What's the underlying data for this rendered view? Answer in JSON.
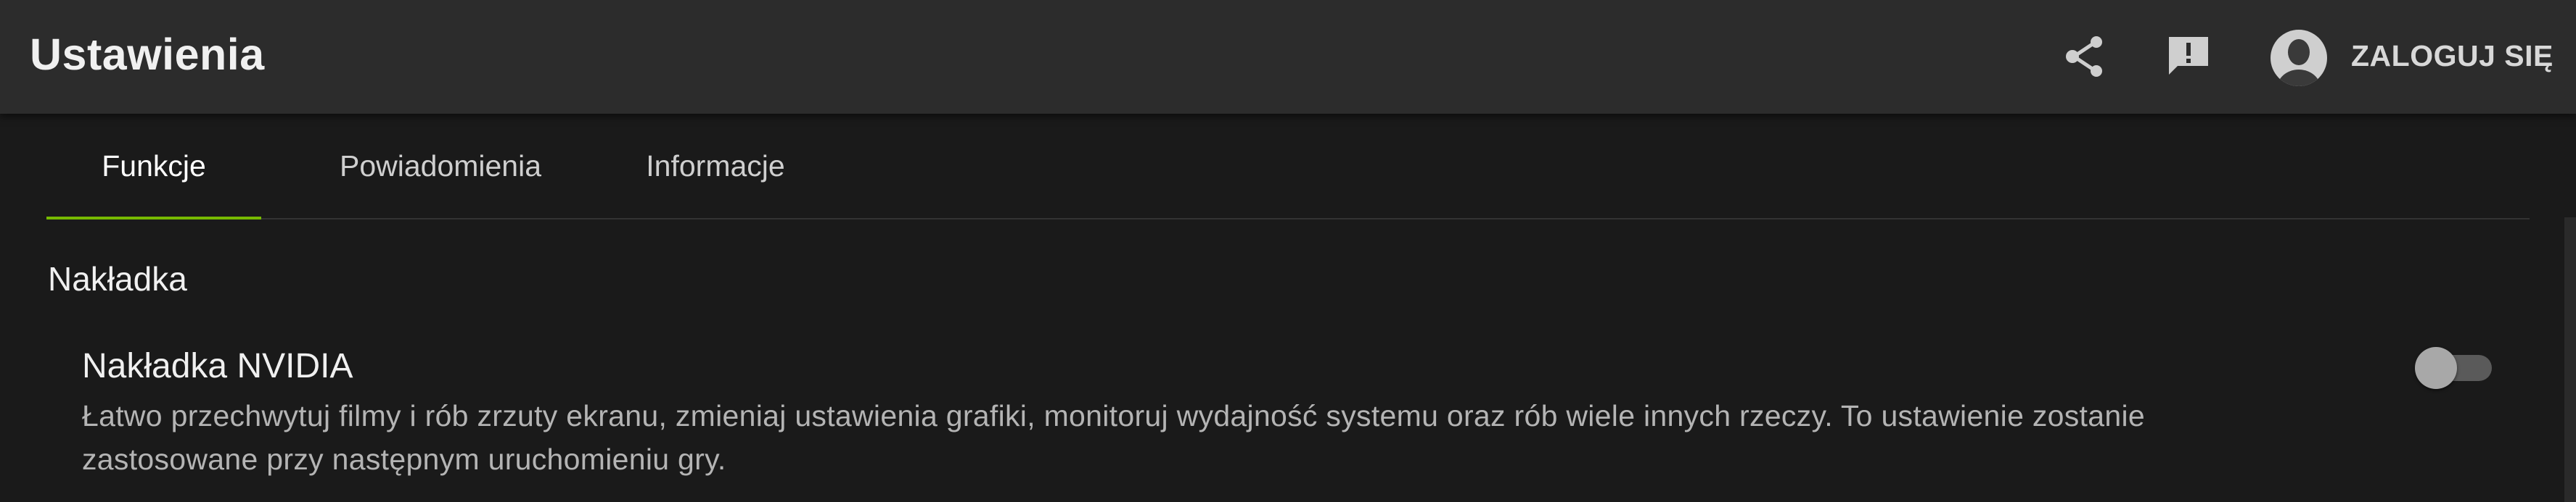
{
  "header": {
    "title": "Ustawienia",
    "share_icon": "share-icon",
    "feedback_icon": "feedback-icon",
    "avatar_icon": "avatar-icon",
    "login_label": "ZALOGUJ SIĘ"
  },
  "tabs": [
    {
      "label": "Funkcje",
      "active": true
    },
    {
      "label": "Powiadomienia",
      "active": false
    },
    {
      "label": "Informacje",
      "active": false
    }
  ],
  "section": {
    "title": "Nakładka",
    "setting": {
      "name": "Nakładka NVIDIA",
      "description_line1": "Łatwo przechwytuj filmy i rób zrzuty ekranu, zmieniaj ustawienia grafiki, monitoruj wydajność systemu oraz rób wiele innych rzeczy. To ustawienie zostanie",
      "description_line2": "zastosowane przy następnym uruchomieniu gry.",
      "enabled": false
    }
  },
  "colors": {
    "accent": "#76b900",
    "header_bg": "#2c2c2c",
    "page_bg": "#1a1a1a"
  }
}
